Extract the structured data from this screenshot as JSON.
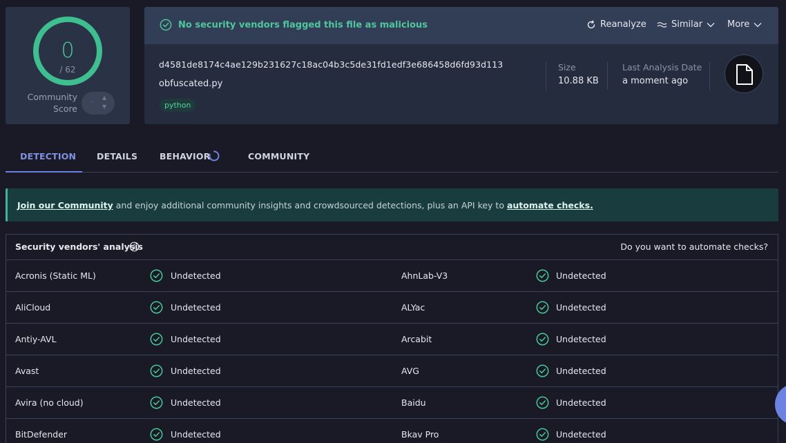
{
  "score": {
    "detections": "0",
    "total": "/ 62",
    "label_line1": "Community",
    "label_line2": "Score",
    "vote_dot": "·"
  },
  "header": {
    "flag_text": "No security vendors flagged this file as malicious",
    "reanalyze_label": "Reanalyze",
    "similar_label": "Similar",
    "more_label": "More"
  },
  "file": {
    "hash": "d4581de8174c4ae129b231627c18ac04b3c5de31fd1edf3e686458d6fd93d113",
    "name": "obfuscated.py",
    "tag": "python",
    "size_label": "Size",
    "size_value": "10.88 KB",
    "date_label": "Last Analysis Date",
    "date_value": "a moment ago"
  },
  "tabs": [
    {
      "label": "DETECTION"
    },
    {
      "label": "DETAILS"
    },
    {
      "label": "BEHAVIOR"
    },
    {
      "label": "COMMUNITY"
    }
  ],
  "banner": {
    "link1": "Join our Community",
    "middle": " and enjoy additional community insights and crowdsourced detections, plus an API key to ",
    "link2": "automate checks."
  },
  "vendors": {
    "title": "Security vendors' analysis",
    "automate_prompt": "Do you want to automate checks?",
    "rows": [
      {
        "left_name": "Acronis (Static ML)",
        "left_result": "Undetected",
        "right_name": "AhnLab-V3",
        "right_result": "Undetected"
      },
      {
        "left_name": "AliCloud",
        "left_result": "Undetected",
        "right_name": "ALYac",
        "right_result": "Undetected"
      },
      {
        "left_name": "Antiy-AVL",
        "left_result": "Undetected",
        "right_name": "Arcabit",
        "right_result": "Undetected"
      },
      {
        "left_name": "Avast",
        "left_result": "Undetected",
        "right_name": "AVG",
        "right_result": "Undetected"
      },
      {
        "left_name": "Avira (no cloud)",
        "left_result": "Undetected",
        "right_name": "Baidu",
        "right_result": "Undetected"
      },
      {
        "left_name": "BitDefender",
        "left_result": "Undetected",
        "right_name": "Bkav Pro",
        "right_result": "Undetected"
      }
    ]
  },
  "colors": {
    "accent": "#6c83e2",
    "clean": "#47c99a",
    "background": "#191a26"
  }
}
